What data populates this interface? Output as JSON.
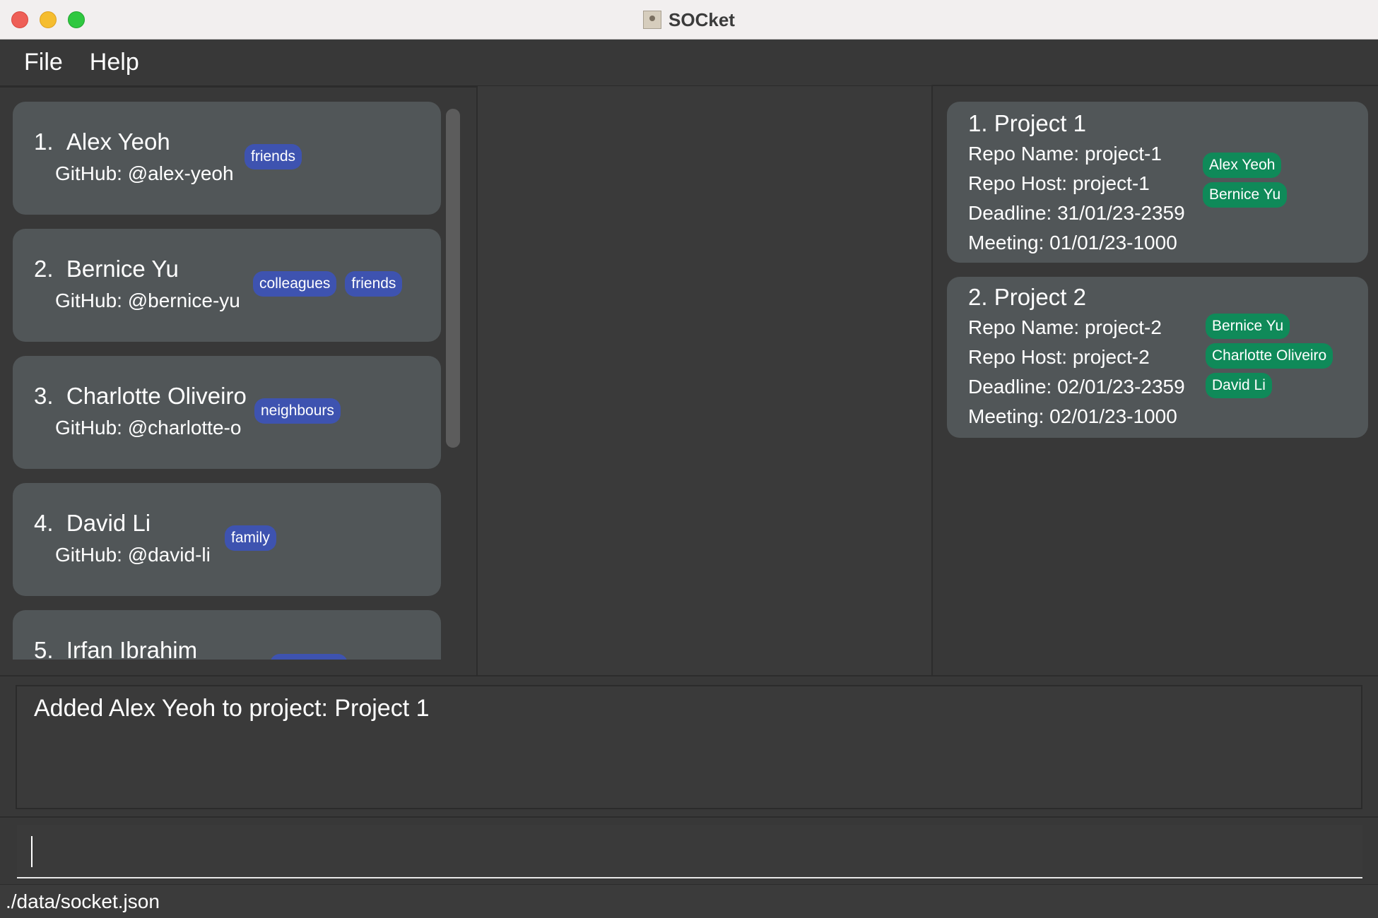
{
  "window": {
    "title": "SOCket"
  },
  "menu": {
    "file": "File",
    "help": "Help"
  },
  "persons": [
    {
      "index": "1.",
      "name": "Alex Yeoh",
      "github": "GitHub: @alex-yeoh",
      "tags": [
        "friends"
      ]
    },
    {
      "index": "2.",
      "name": "Bernice Yu",
      "github": "GitHub: @bernice-yu",
      "tags": [
        "colleagues",
        "friends"
      ]
    },
    {
      "index": "3.",
      "name": "Charlotte Oliveiro",
      "github": "GitHub: @charlotte-o",
      "tags": [
        "neighbours"
      ]
    },
    {
      "index": "4.",
      "name": "David Li",
      "github": "GitHub: @david-li",
      "tags": [
        "family"
      ]
    },
    {
      "index": "5.",
      "name": "Irfan Ibrahim",
      "github": "",
      "tags": []
    }
  ],
  "projects": [
    {
      "title": "1.  Project 1",
      "repo_name": "Repo Name: project-1",
      "repo_host": "Repo Host: project-1",
      "deadline": "Deadline: 31/01/23-2359",
      "meeting": "Meeting: 01/01/23-1000",
      "members": [
        "Alex Yeoh",
        "Bernice Yu"
      ]
    },
    {
      "title": "2.  Project 2",
      "repo_name": "Repo Name: project-2",
      "repo_host": "Repo Host: project-2",
      "deadline": "Deadline: 02/01/23-2359",
      "meeting": "Meeting: 02/01/23-1000",
      "members": [
        "Bernice Yu",
        "Charlotte Oliveiro",
        "David Li"
      ]
    }
  ],
  "result": {
    "message": "Added Alex Yeoh to project: Project 1"
  },
  "command": {
    "value": "",
    "placeholder": ""
  },
  "status": {
    "file_path": "./data/socket.json"
  },
  "colors": {
    "tag_blue": "#3e53b0",
    "tag_green": "#0f8a59",
    "card_bg": "#515658",
    "window_bg": "#3a3a3a"
  }
}
